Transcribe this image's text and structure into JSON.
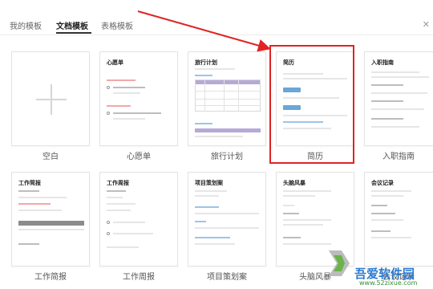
{
  "tabs": [
    {
      "label": "我的模板"
    },
    {
      "label": "文档模板"
    },
    {
      "label": "表格模板"
    }
  ],
  "close_icon": "close-icon",
  "row1": [
    {
      "label": "空白",
      "title": ""
    },
    {
      "label": "心愿单",
      "title": "心愿单"
    },
    {
      "label": "旅行计划",
      "title": "旅行计划"
    },
    {
      "label": "简历",
      "title": "简历"
    },
    {
      "label": "入职指南",
      "title": "入职指南"
    }
  ],
  "row2": [
    {
      "label": "工作简报",
      "title": "工作简报"
    },
    {
      "label": "工作周报",
      "title": "工作周报"
    },
    {
      "label": "项目策划案",
      "title": "项目策划案"
    },
    {
      "label": "头脑风暴",
      "title": "头脑风暴"
    },
    {
      "label": "会议记录",
      "title": "会议记录"
    }
  ],
  "watermark": {
    "text": "吾爱软件园",
    "url": "www.52zixue.com"
  },
  "colors": {
    "highlight": "#e02424",
    "accent_blue": "#6aa6d8",
    "table_head": "#b6a9d6"
  }
}
